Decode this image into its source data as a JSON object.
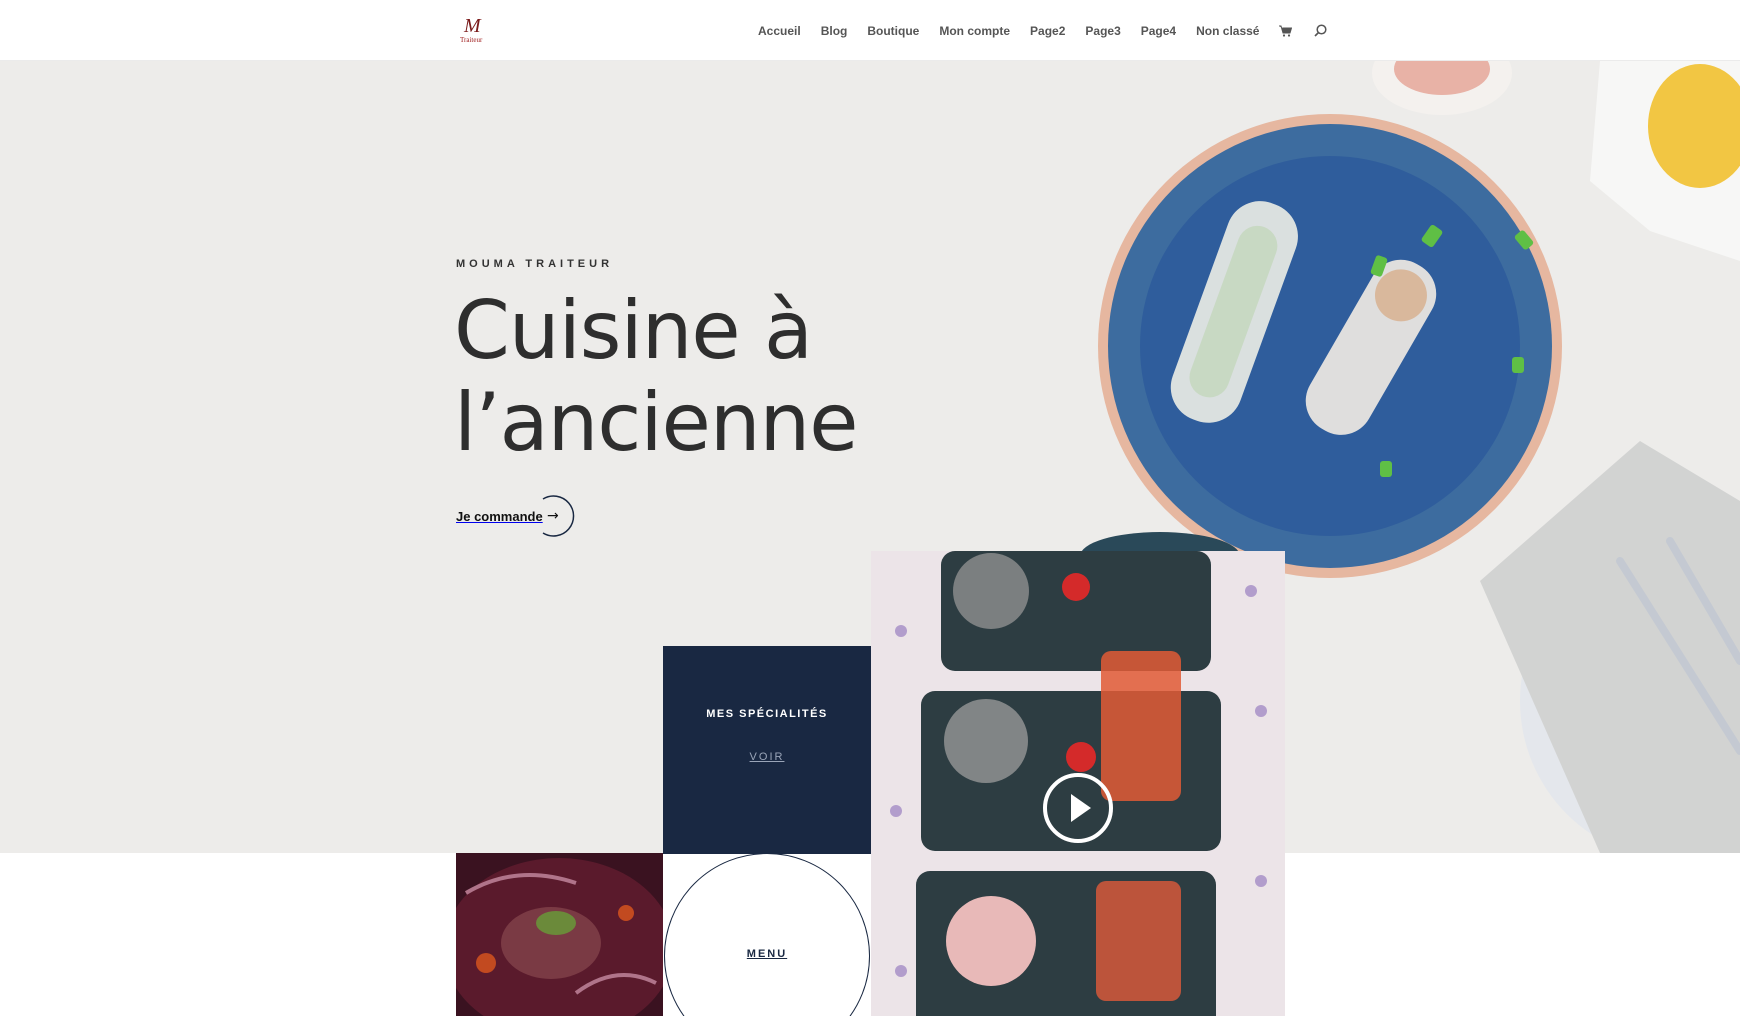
{
  "header": {
    "logo_text": "Traiteur",
    "nav": [
      "Accueil",
      "Blog",
      "Boutique",
      "Mon compte",
      "Page2",
      "Page3",
      "Page4",
      "Non classé"
    ],
    "icons": [
      "cart-icon",
      "search-icon"
    ]
  },
  "hero": {
    "eyebrow": "MOUMA TRAITEUR",
    "title_line1": "Cuisine à",
    "title_line2": "l’ancienne",
    "cta_label": "Je commande",
    "cta_arrow": "→"
  },
  "specialites": {
    "title": "MES SPÉCIALITÉS",
    "link": "VOIR"
  },
  "menu_tile": {
    "label": "MENU"
  },
  "colors": {
    "navy": "#192842",
    "hero_bg": "#edecea",
    "plate_blue": "#2f5d9c"
  }
}
